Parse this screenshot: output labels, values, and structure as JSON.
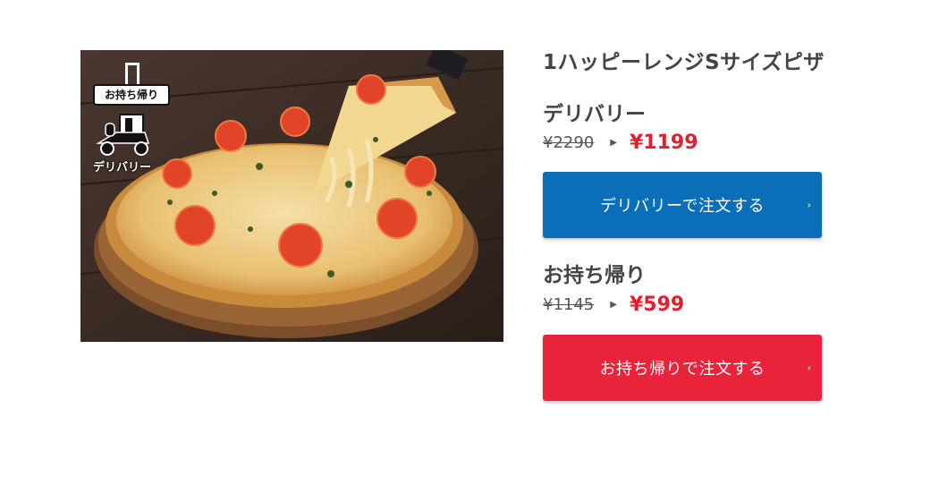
{
  "product": {
    "title": "1ハッピーレンジSサイズピザ",
    "image_alt": "pizza"
  },
  "badges": {
    "takeout_label": "お持ち帰り",
    "takeout_icon": "takeout-bag-icon",
    "delivery_label": "デリバリー",
    "delivery_icon": "delivery-scooter-icon"
  },
  "delivery": {
    "label": "デリバリー",
    "old_price": "¥2290",
    "arrow": "▶",
    "new_price": "¥1199",
    "button_label": "デリバリーで注文する",
    "button_color": "#0a6fb8"
  },
  "takeout": {
    "label": "お持ち帰り",
    "old_price": "¥1145",
    "arrow": "▶",
    "new_price": "¥599",
    "button_label": "お持ち帰りで注文する",
    "button_color": "#e8233a"
  },
  "chevron": "›",
  "colors": {
    "price_red": "#e0202f",
    "text_dark": "#444444"
  }
}
